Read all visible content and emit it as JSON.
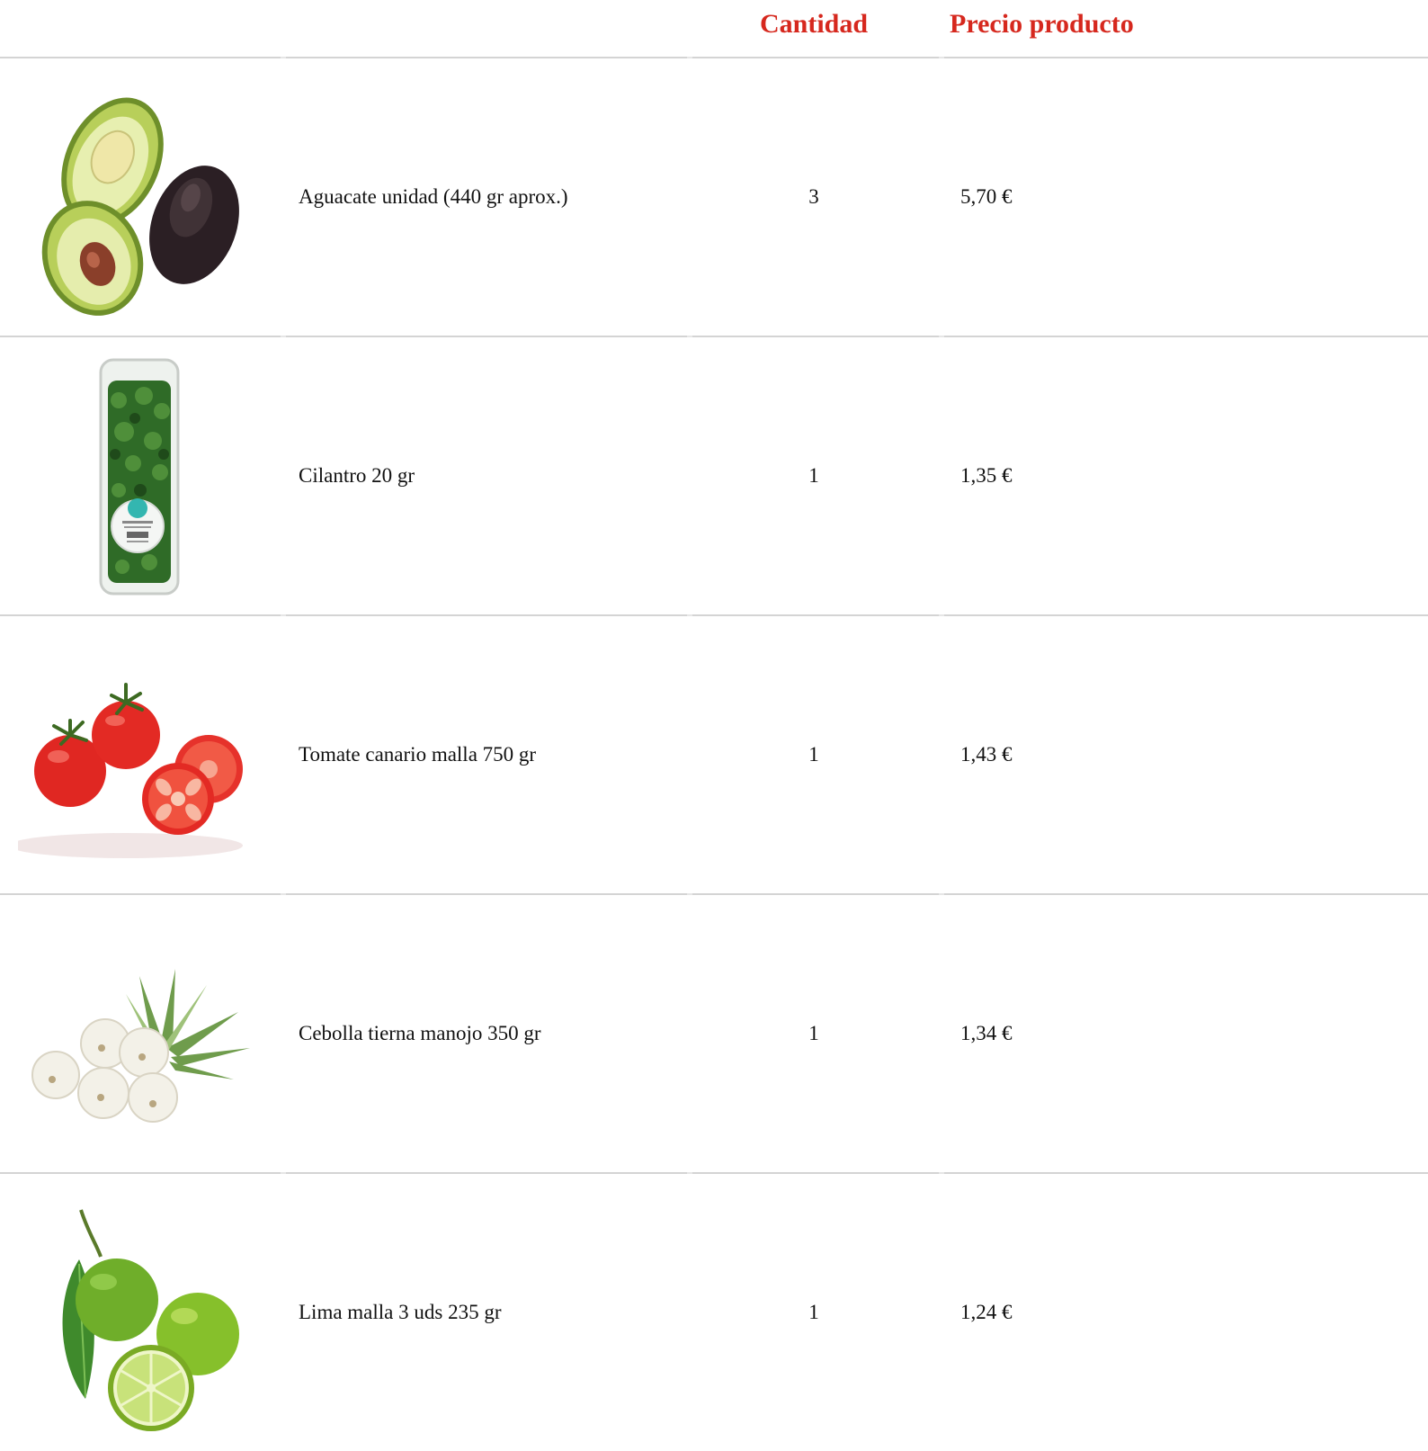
{
  "header": {
    "quantity_label": "Cantidad",
    "price_label": "Precio producto"
  },
  "colors": {
    "header_text": "#d6281e",
    "divider": "#d4d4d4",
    "body_text": "#111111"
  },
  "products": [
    {
      "name": "Aguacate unidad (440 gr aprox.)",
      "quantity": "3",
      "price": "5,70 €",
      "image": "avocado-image"
    },
    {
      "name": "Cilantro 20 gr",
      "quantity": "1",
      "price": "1,35 €",
      "image": "cilantro-pack-image"
    },
    {
      "name": "Tomate canario malla 750 gr",
      "quantity": "1",
      "price": "1,43 €",
      "image": "tomato-image"
    },
    {
      "name": "Cebolla tierna manojo 350 gr",
      "quantity": "1",
      "price": "1,34 €",
      "image": "spring-onion-image"
    },
    {
      "name": "Lima malla 3 uds 235 gr",
      "quantity": "1",
      "price": "1,24 €",
      "image": "lime-image"
    }
  ]
}
